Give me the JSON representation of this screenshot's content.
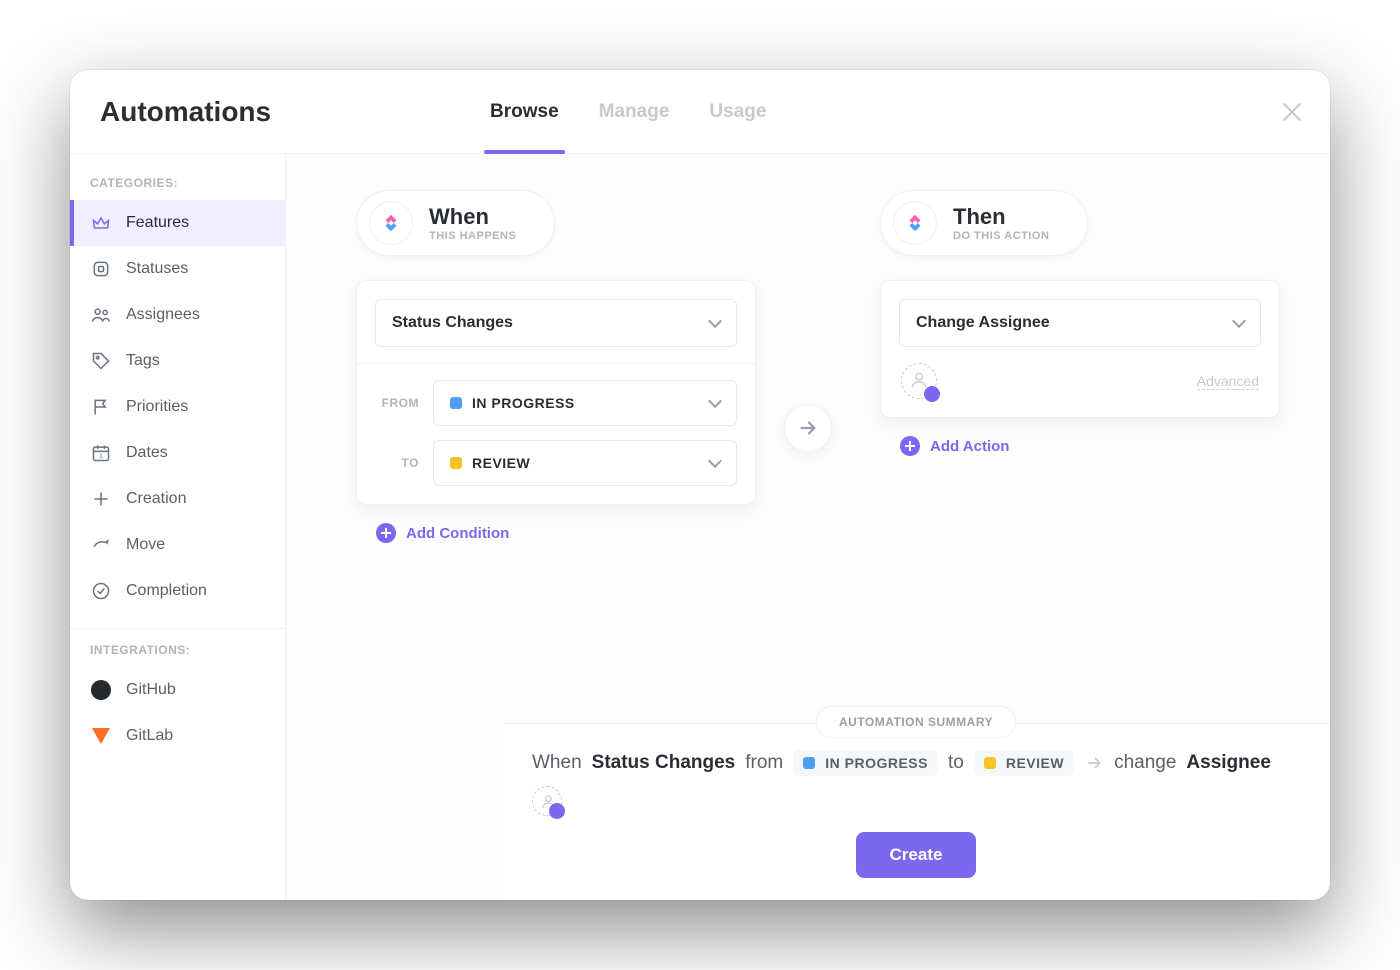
{
  "header": {
    "title": "Automations",
    "tabs": {
      "browse": "Browse",
      "manage": "Manage",
      "usage": "Usage"
    },
    "active_tab": "browse"
  },
  "sidebar": {
    "categories_label": "CATEGORIES:",
    "integrations_label": "INTEGRATIONS:",
    "items": [
      {
        "label": "Features",
        "icon": "crown-icon",
        "active": true
      },
      {
        "label": "Statuses",
        "icon": "square-icon"
      },
      {
        "label": "Assignees",
        "icon": "people-icon"
      },
      {
        "label": "Tags",
        "icon": "tag-icon"
      },
      {
        "label": "Priorities",
        "icon": "flag-icon"
      },
      {
        "label": "Dates",
        "icon": "calendar-icon"
      },
      {
        "label": "Creation",
        "icon": "plus-icon"
      },
      {
        "label": "Move",
        "icon": "arrow-icon"
      },
      {
        "label": "Completion",
        "icon": "check-circle-icon"
      }
    ],
    "integrations": [
      {
        "label": "GitHub",
        "icon": "github-icon"
      },
      {
        "label": "GitLab",
        "icon": "gitlab-icon"
      }
    ]
  },
  "when": {
    "title": "When",
    "subtitle": "THIS HAPPENS",
    "trigger": "Status Changes",
    "from_label": "FROM",
    "to_label": "TO",
    "from_status": {
      "name": "IN PROGRESS",
      "color": "#4f9ef8"
    },
    "to_status": {
      "name": "REVIEW",
      "color": "#f7c325"
    },
    "add_condition_label": "Add Condition"
  },
  "then": {
    "title": "Then",
    "subtitle": "DO THIS ACTION",
    "action": "Change Assignee",
    "advanced_label": "Advanced",
    "add_action_label": "Add Action"
  },
  "summary": {
    "pill": "AUTOMATION SUMMARY",
    "text": {
      "when": "When",
      "trigger": "Status Changes",
      "from": "from",
      "to": "to",
      "change": "change",
      "assignee": "Assignee"
    },
    "create_label": "Create"
  },
  "colors": {
    "accent": "#7b68ee"
  }
}
